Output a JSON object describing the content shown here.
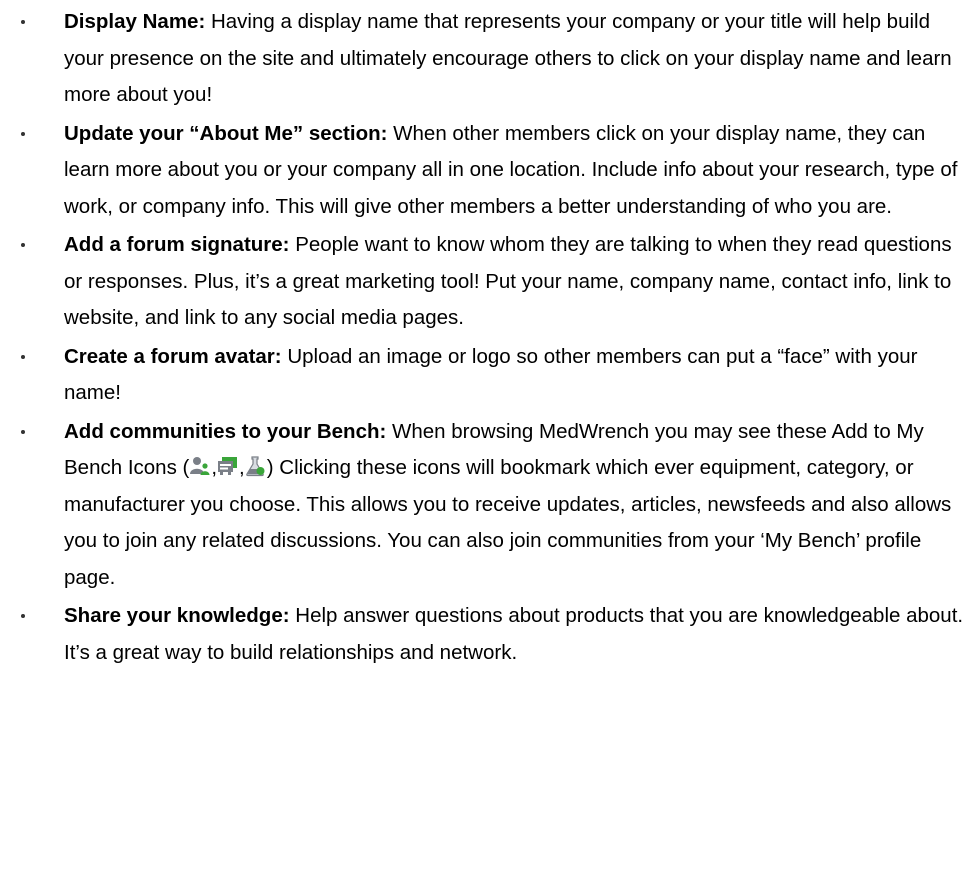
{
  "items": [
    {
      "heading": "Display Name:",
      "text": " Having a display name that represents your company or your title will help build your presence on the site and ultimately encourage others to click on your display name and learn more about you!"
    },
    {
      "heading": "Update your “About Me” section:",
      "text": " When other members click on your display name, they can learn more about you or your company all in one location. Include info about your research, type of work, or company info. This will give other members a better understanding of who you are."
    },
    {
      "heading": "Add a forum signature:",
      "text": " People want to know whom they are talking to when they read questions or responses. Plus, it’s a great marketing tool! Put your name, company name, contact info, link to website, and link to any social media pages."
    },
    {
      "heading": "Create a forum avatar:",
      "text": " Upload an image or logo so other members can put a “face” with your name!"
    },
    {
      "heading": "Add communities to your Bench:",
      "text_before_icons": " When browsing MedWrench you may see these Add to My Bench Icons (",
      "icon_separator": ",",
      "text_after_icons": ") Clicking these icons will bookmark which ever equipment, category, or manufacturer you choose. This allows you to receive updates, articles, newsfeeds and also allows you to join any related discussions. You can also join communities from your ‘My Bench’ profile page.",
      "icons": [
        "add-user-icon",
        "add-category-icon",
        "add-manufacturer-flask-icon"
      ]
    },
    {
      "heading": "Share your knowledge:",
      "text": " Help answer questions about products that you are knowledgeable about. It’s a great way to build relationships and network."
    }
  ],
  "colors": {
    "text": "#000000",
    "icon_green": "#3aa53a",
    "icon_gray": "#7a7f87"
  }
}
